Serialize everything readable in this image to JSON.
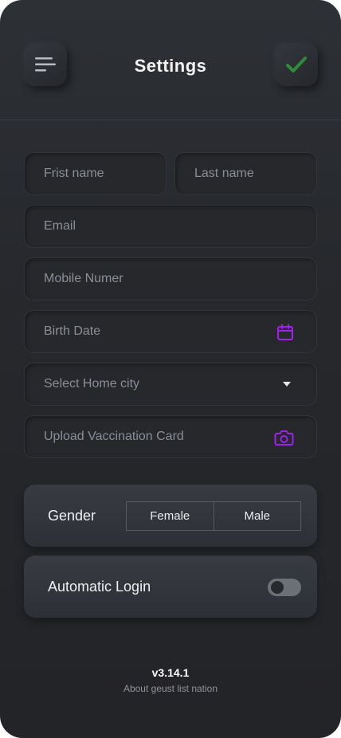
{
  "header": {
    "title": "Settings",
    "menu_icon": "menu-icon",
    "confirm_icon": "check-icon"
  },
  "form": {
    "first_name_placeholder": "Frist name",
    "last_name_placeholder": "Last name",
    "email_placeholder": "Email",
    "mobile_placeholder": "Mobile Numer",
    "birth_date_placeholder": "Birth Date",
    "home_city_placeholder": "Select Home city",
    "vaccination_placeholder": "Upload Vaccination Card"
  },
  "gender": {
    "label": "Gender",
    "options": [
      "Female",
      "Male"
    ]
  },
  "auto_login": {
    "label": "Automatic Login",
    "enabled": false
  },
  "footer": {
    "version": "v3.14.1",
    "about": "About geust list nation"
  },
  "colors": {
    "accent_purple": "#a020f0",
    "check_green": "#2e8b3a",
    "background": "#26282c"
  }
}
